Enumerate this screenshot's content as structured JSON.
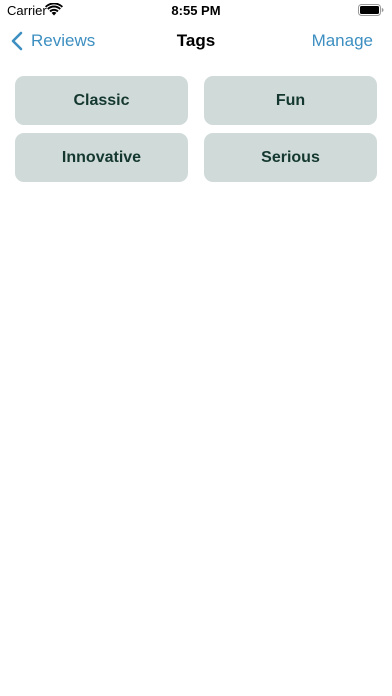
{
  "status_bar": {
    "carrier": "Carrier",
    "time": "8:55 PM",
    "icons": [
      "wifi-icon",
      "battery-icon"
    ]
  },
  "nav": {
    "back_label": "Reviews",
    "back_icon": "chevron-left-icon",
    "title": "Tags",
    "manage_label": "Manage"
  },
  "tags": [
    {
      "label": "Classic"
    },
    {
      "label": "Fun"
    },
    {
      "label": "Innovative"
    },
    {
      "label": "Serious"
    }
  ],
  "colors": {
    "accent": "#3d8fc1",
    "tag_background": "#d0dad9",
    "tag_text": "#14382f"
  }
}
